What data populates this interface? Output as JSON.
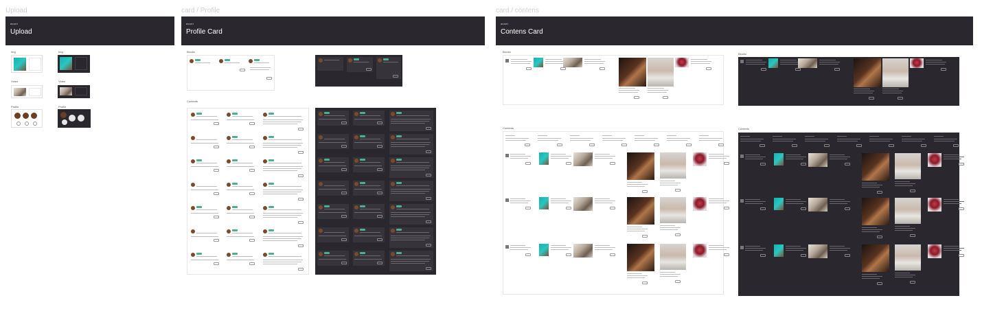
{
  "frames": [
    {
      "label": "Upload",
      "asset_label": "asset",
      "title": "Upload"
    },
    {
      "label": "card / Profile",
      "asset_label": "asset",
      "title": "Profile Card"
    },
    {
      "label": "card / contens",
      "asset_label": "asset",
      "title": "Contens Card"
    }
  ],
  "upload": {
    "sections": [
      "Img",
      "Img",
      "Video",
      "Video",
      "Profile",
      "Profile"
    ]
  },
  "profile": {
    "sections": [
      "Blocks",
      "Contents"
    ]
  },
  "contents": {
    "sections": [
      "Blocks",
      "Blocks",
      "Contents",
      "Contents"
    ]
  },
  "colors": {
    "dark_bg": "#2a282e",
    "accent": "#4caf8f",
    "frame_label": "#cfcfcf"
  }
}
